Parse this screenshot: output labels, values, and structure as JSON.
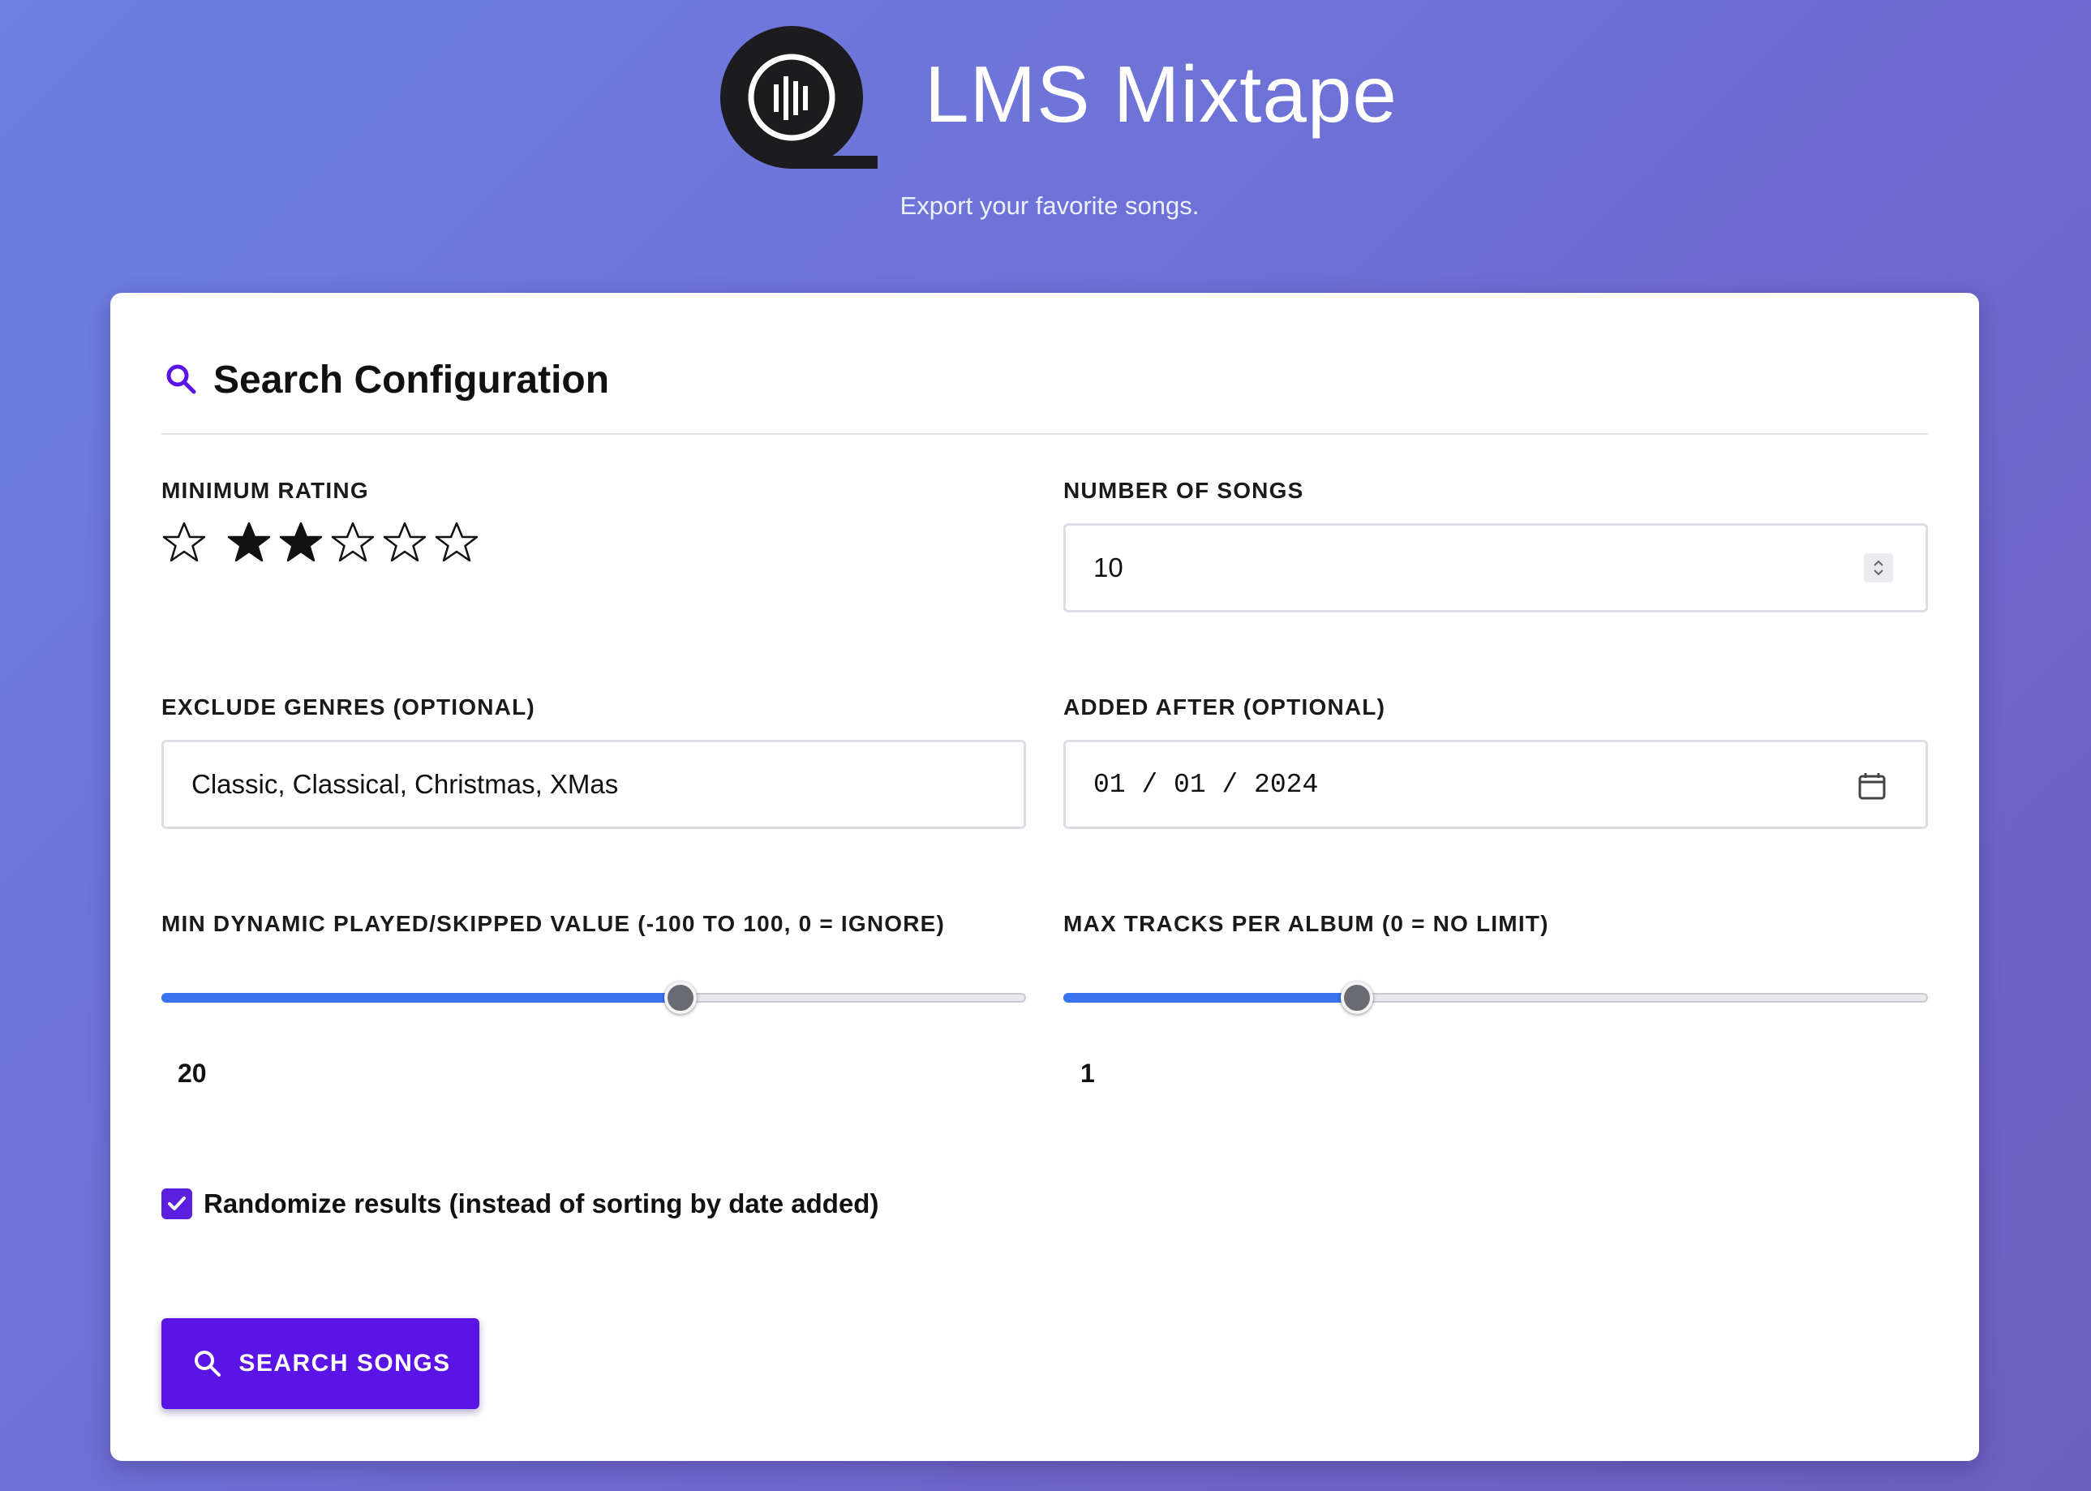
{
  "header": {
    "title": "LMS Mixtape",
    "tagline": "Export your favorite songs.",
    "logo_icon": "soundwave-reel-icon"
  },
  "search": {
    "title": "Search Configuration",
    "icon": "search-icon",
    "accent_color": "#5b14e6",
    "min_rating": {
      "label": "MINIMUM RATING",
      "value": 2,
      "max": 5,
      "star_icons": [
        "empty-star",
        "filled-star",
        "filled-star",
        "empty-star",
        "empty-star",
        "empty-star"
      ]
    },
    "num_songs": {
      "label": "NUMBER OF SONGS",
      "value": "10"
    },
    "exclude_genres": {
      "label": "EXCLUDE GENRES (OPTIONAL)",
      "value": "Classic, Classical, Christmas, XMas"
    },
    "added_after": {
      "label": "ADDED AFTER (OPTIONAL)",
      "display": "01 / 01 / 2024",
      "value": "2024-01-01"
    },
    "dynamic_played": {
      "label": "MIN DYNAMIC PLAYED/SKIPPED VALUE (-100 TO 100, 0 = IGNORE)",
      "value": "20",
      "min": -100,
      "max": 100,
      "fraction": 0.6
    },
    "max_tracks_album": {
      "label": "MAX TRACKS PER ALBUM (0 = NO LIMIT)",
      "value": "1",
      "fraction": 0.34
    },
    "randomize": {
      "label": "Randomize results (instead of sorting by date added)",
      "checked": true
    },
    "submit": {
      "label": "SEARCH SONGS"
    }
  }
}
